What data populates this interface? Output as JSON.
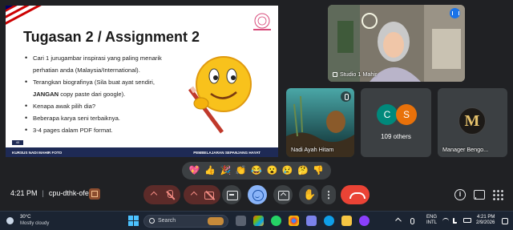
{
  "slide": {
    "title": "Tugasan 2 / Assignment 2",
    "bullets": [
      {
        "text": "Cari 1 jurugambar inspirasi yang paling menarik",
        "sub": false
      },
      {
        "text": "perhatian anda (Malaysia/International).",
        "sub": true
      },
      {
        "text": "Terangkan biografinya (Sila buat ayat sendiri,",
        "sub": false
      },
      {
        "bold": "JANGAN",
        "text": " copy paste dari google).",
        "sub": true
      },
      {
        "text": "Kenapa awak pilih dia?",
        "sub": false
      },
      {
        "text": "Beberapa karya seni terbaiknya.",
        "sub": false
      },
      {
        "text": "3-4 pages dalam PDF format.",
        "sub": false
      }
    ],
    "footer_left": "KURSUS NADI MAHIR FOTO",
    "footer_right": "PEMBELAJARAN SEPANJANG HAYAT",
    "slide_number": "40"
  },
  "tiles": {
    "speaker": {
      "name": "Studio 1 Mahir"
    },
    "ocean": {
      "name": "Nadi Ayah Hitam"
    },
    "others": {
      "avatar1": "C",
      "avatar2": "S",
      "label": "109 others"
    },
    "manager": {
      "name": "Manager Bengo...",
      "avatar_letter": "M"
    }
  },
  "reactions": [
    "💖",
    "👍",
    "🎉",
    "👏",
    "😂",
    "😮",
    "😢",
    "🤔",
    "👎"
  ],
  "meeting_bar": {
    "time": "4:21 PM",
    "separator": "|",
    "meeting_code": "cpu-dthk-ofe",
    "hand_icon": "✋",
    "more_icon": "⋮",
    "info_icon": "i"
  },
  "taskbar": {
    "temp": "30°C",
    "condition": "Mostly cloudy",
    "search_placeholder": "Search",
    "lang_line1": "ENG",
    "lang_line2": "INTL",
    "clock_time": "4:21 PM",
    "clock_date": "2/9/2026"
  },
  "colors": {
    "meet_bg": "#202124",
    "hangup_red": "#ea4335",
    "muted_red": "#5c2b29",
    "active_blue": "#8ab4f8",
    "slide_footer": "#1e2a55",
    "taskbar_bg": "#1b2432"
  },
  "icons": [
    "mic-off-icon",
    "camera-off-icon",
    "captions-icon",
    "emoji-icon",
    "present-icon",
    "raise-hand-icon",
    "more-options-icon",
    "hang-up-icon",
    "info-icon",
    "chat-icon",
    "activities-icon",
    "windows-start-icon",
    "search-icon"
  ]
}
